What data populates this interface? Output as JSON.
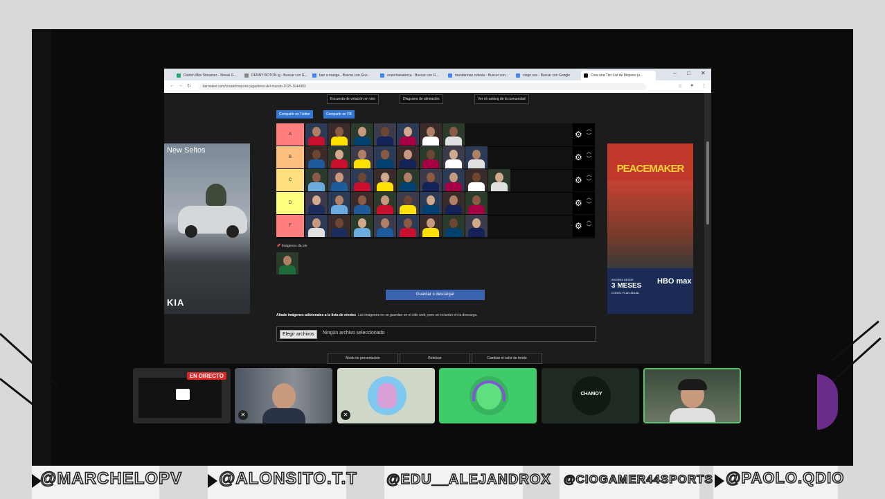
{
  "browser": {
    "tabs": [
      {
        "label": "Ostrich Mini Streamer - Streak G..."
      },
      {
        "label": "DENNY BOTON ig - Buscar con G..."
      },
      {
        "label": "ban a manga - Buscar con Goo..."
      },
      {
        "label": "oranchaisaterca - Buscar con G..."
      },
      {
        "label": "mandarinas celeste - Buscar con..."
      },
      {
        "label": "ciego sos - Buscar con Google"
      },
      {
        "label": "Crea una Tier List de Mejores ju..."
      }
    ],
    "url": "tiermaker.com/create/mejores-jugadores-del-mundo-2025-1644983",
    "window_controls": {
      "minimize": "–",
      "maximize": "□",
      "close": "✕"
    }
  },
  "page": {
    "top_buttons": [
      "Encuesta de votación en vivo",
      "Diagrama de alineación",
      "Ver el ranking de la comunidad"
    ],
    "share_buttons": [
      "Compartir en Twitter",
      "Compartir en FB"
    ],
    "tiers": [
      {
        "label": "A",
        "color": "#ff7f7f",
        "count": 7
      },
      {
        "label": "B",
        "color": "#ffbf7f",
        "count": 8
      },
      {
        "label": "C",
        "color": "#ffdf7f",
        "count": 9
      },
      {
        "label": "D",
        "color": "#ffff7f",
        "count": 8
      },
      {
        "label": "F",
        "color": "#ff7f7f",
        "count": 8
      }
    ],
    "pool_label": "Imágenes de pie",
    "save_button": "Guardar o descargar",
    "add_images_bold": "Añade imágenes adicionales a la lista de niveles",
    "add_images_note": "Las imágenes no se guardan en el sitio web, pero se incluirán en la descarga.",
    "file_button": "Elegir archivos",
    "file_status": "Ningún archivo seleccionado",
    "bottom_buttons": [
      "Modo de presentación",
      "Reiniciar",
      "Cambiar el color de fondo"
    ]
  },
  "ads": {
    "left_title": "New Seltos",
    "left_brand": "KIA",
    "right_title": "PEACEMAKER",
    "right_line1": "AHORRA DESDE",
    "right_line2": "3 MESES",
    "right_line3": "CON EL PLAN ANUAL",
    "right_brand": "HBO max"
  },
  "call": {
    "live_badge": "EN DIRECTO",
    "tiles": [
      "screen-share",
      "alonsito",
      "edu",
      "chamoy-green",
      "chamoy",
      "paolo"
    ],
    "chamoy_label": "CHAMOY"
  },
  "nameplates": [
    "@MARCHELOPV",
    "@ALONSITO.T.T",
    "@EDU__ALEJANDROX",
    "@CIOGAMER44SPORTS",
    "@PAOLO.QDIO"
  ],
  "colors": {
    "accent": "#3478d4",
    "save": "#3c63b0",
    "speaking": "#55c46a"
  }
}
